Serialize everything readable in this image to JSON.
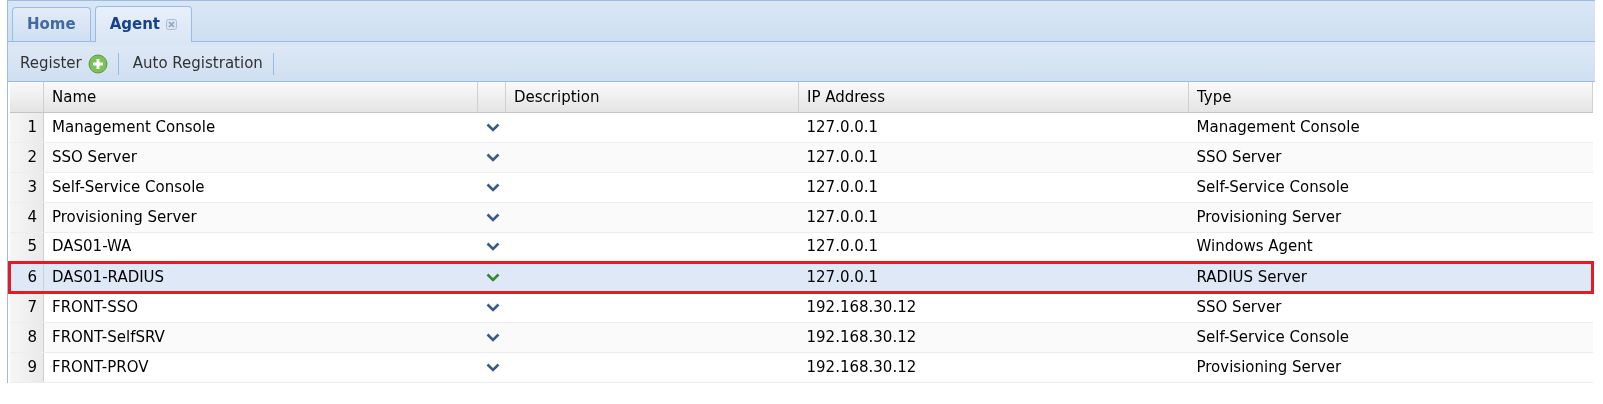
{
  "tabs": [
    {
      "label": "Home",
      "selected": false,
      "closable": false
    },
    {
      "label": "Agent",
      "selected": true,
      "closable": true
    }
  ],
  "toolbar": [
    {
      "label": "Register",
      "kind": "add"
    },
    {
      "label": "Auto Registration",
      "kind": "plain"
    }
  ],
  "table": {
    "columns": [
      "Name",
      "Description",
      "IP Address",
      "Type"
    ],
    "rows": [
      {
        "number": "1",
        "name": "Management Console",
        "ip": "127.0.0.1",
        "type": "Management Console",
        "selected": false
      },
      {
        "number": "2",
        "name": "SSO Server",
        "ip": "127.0.0.1",
        "type": "SSO Server",
        "selected": false
      },
      {
        "number": "3",
        "name": "Self-Service Console",
        "ip": "127.0.0.1",
        "type": "Self-Service Console",
        "selected": false
      },
      {
        "number": "4",
        "name": "Provisioning Server",
        "ip": "127.0.0.1",
        "type": "Provisioning Server",
        "selected": false
      },
      {
        "number": "5",
        "name": "DAS01-WA",
        "ip": "127.0.0.1",
        "type": "Windows Agent",
        "selected": false
      },
      {
        "number": "6",
        "name": "DAS01-RADIUS",
        "ip": "127.0.0.1",
        "type": "RADIUS Server",
        "selected": true
      },
      {
        "number": "7",
        "name": "FRONT-SSO",
        "ip": "192.168.30.12",
        "type": "SSO Server",
        "selected": false
      },
      {
        "number": "8",
        "name": "FRONT-SelfSRV",
        "ip": "192.168.30.12",
        "type": "Self-Service Console",
        "selected": false
      },
      {
        "number": "9",
        "name": "FRONT-PROV",
        "ip": "192.168.30.12",
        "type": "Provisioning Server",
        "selected": false
      }
    ]
  }
}
